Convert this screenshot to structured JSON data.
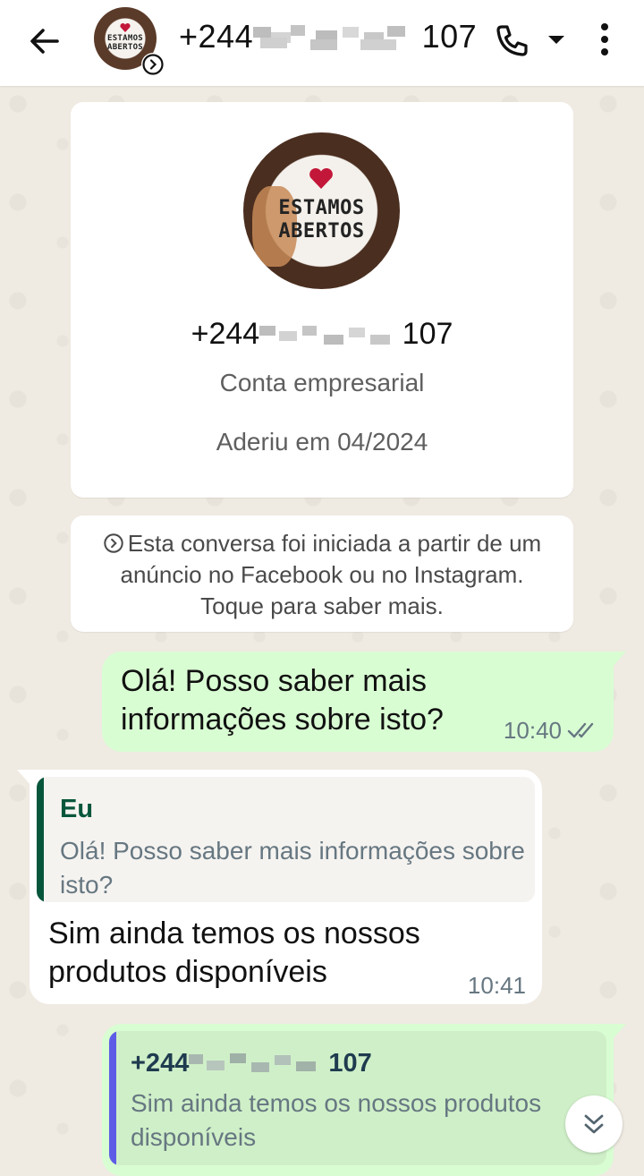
{
  "header": {
    "back_icon": "arrow-left-icon",
    "avatar_logo_line1": "ESTAMOS",
    "avatar_logo_line2": "ABERTOS",
    "ad_badge_icon": "chevron-right-circle-icon",
    "title_prefix": "+244",
    "title_suffix": "107",
    "call_icon": "phone-icon",
    "dropdown_icon": "caret-down-icon",
    "menu_icon": "more-vertical-icon"
  },
  "profile_card": {
    "logo_line1": "ESTAMOS",
    "logo_line2": "ABERTOS",
    "phone_prefix": "+244",
    "phone_suffix": "107",
    "account_type": "Conta empresarial",
    "joined": "Aderiu em 04/2024"
  },
  "notice": {
    "icon": "chevron-right-circle-icon",
    "text": "Esta conversa foi iniciada a partir de um anúncio no Facebook ou no Instagram. Toque para saber mais."
  },
  "messages": [
    {
      "direction": "outgoing",
      "text_line1": "Olá! Posso saber mais",
      "text_line2": "informações sobre isto?",
      "time": "10:40",
      "status_icon": "double-check-icon"
    },
    {
      "direction": "incoming",
      "quote_author": "Eu",
      "quote_text": "Olá! Posso saber mais informações sobre isto?",
      "text_line1": "Sim ainda temos os nossos",
      "text_line2": "produtos disponíveis",
      "time": "10:41"
    },
    {
      "direction": "outgoing",
      "quote_author_prefix": "+244",
      "quote_author_suffix": "107",
      "quote_text": "Sim ainda temos os nossos produtos disponíveis"
    }
  ],
  "scroll_button_icon": "double-chevron-down-icon",
  "colors": {
    "outgoing_bubble": "#d9fdd3",
    "incoming_bubble": "#ffffff",
    "quote_accent_self": "#06563b",
    "quote_accent_contact": "#5e5ce6",
    "wallpaper": "#efeae2"
  }
}
